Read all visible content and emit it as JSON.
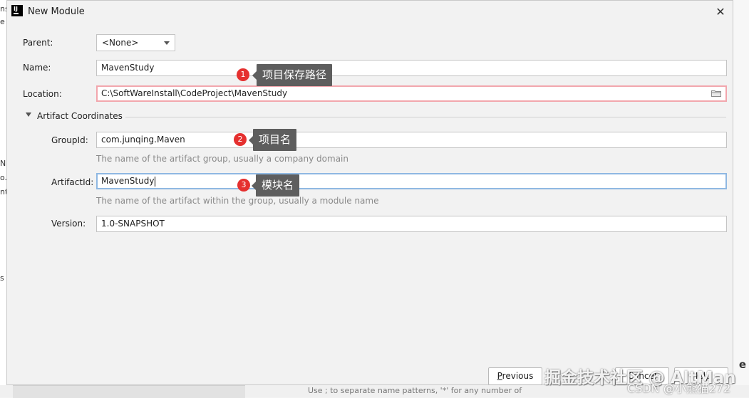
{
  "background": {
    "left_fragments": [
      "ns",
      "e",
      "N",
      "o.",
      "nt",
      "s"
    ],
    "bottom_hint": "Use ; to separate name patterns, '*' for any number of",
    "right_fragment": "e"
  },
  "dialog": {
    "title": "New Module",
    "icon_text": "IJ",
    "close_glyph": "✕"
  },
  "form": {
    "parent_label": "Parent:",
    "parent_value": "<None>",
    "name_label": "Name:",
    "name_value": "MavenStudy",
    "location_label": "Location:",
    "location_value": "C:\\SoftWareInstall\\CodeProject\\MavenStudy",
    "section_title": "Artifact Coordinates",
    "groupid_label": "GroupId:",
    "groupid_value": "com.junqing.Maven",
    "groupid_hint": "The name of the artifact group, usually a company domain",
    "artifactid_label": "ArtifactId:",
    "artifactid_value": "MavenStudy",
    "artifactid_hint": "The name of the artifact within the group, usually a module name",
    "version_label": "Version:",
    "version_value": "1.0-SNAPSHOT"
  },
  "annotations": [
    {
      "number": "1",
      "text": "项目保存路径"
    },
    {
      "number": "2",
      "text": "项目名"
    },
    {
      "number": "3",
      "text": "模块名"
    }
  ],
  "buttons": {
    "previous_mnemonic": "P",
    "previous_rest": "revious",
    "cancel": "Cancel",
    "help": "Help"
  },
  "watermark": {
    "line1": "掘金技术社区 @ AltMan",
    "line2": "CSDN @小熊猫272"
  },
  "colors": {
    "error_border": "#f2a6ad",
    "focus_border": "#8fb8e2",
    "badge": "#e5302f",
    "tooltip": "#5e5e5e"
  }
}
